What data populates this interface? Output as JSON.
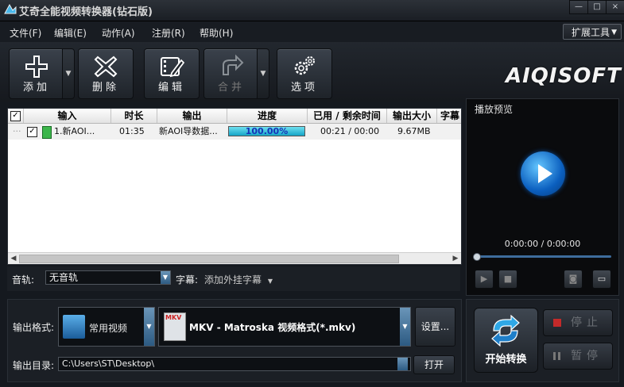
{
  "window": {
    "title": "艾奇全能视频转换器(钻石版)",
    "min": "—",
    "max": "□",
    "close": "×"
  },
  "menu": {
    "items": [
      "文件(F)",
      "编辑(E)",
      "动作(A)",
      "注册(R)",
      "帮助(H)"
    ],
    "extension_tools": "扩展工具"
  },
  "toolbar": {
    "add": "添加",
    "delete": "删除",
    "edit": "编辑",
    "merge": "合并",
    "options": "选项"
  },
  "brand": {
    "logo": "AIQISOFT"
  },
  "file_list": {
    "columns": [
      "输入",
      "时长",
      "输出",
      "进度",
      "已用 / 剩余时间",
      "输出大小",
      "字幕"
    ],
    "rows": [
      {
        "checked": true,
        "input": "1.新AOI...",
        "duration": "01:35",
        "output": "新AOI导数据...",
        "progress_percent": 100,
        "progress_text": "100.00%",
        "time": "00:21 / 00:00",
        "size": "9.67MB",
        "subtitle": ""
      }
    ]
  },
  "audio": {
    "label": "音轨:",
    "value": "无音轨",
    "subtitle_label": "字幕:",
    "subtitle_value": "添加外挂字幕"
  },
  "preview": {
    "title": "播放预览",
    "time": "0:00:00 / 0:00:00",
    "seek_fraction": 0.0
  },
  "output": {
    "format_label": "输出格式:",
    "category": "常用视频",
    "format": "MKV - Matroska 视频格式(*.mkv)",
    "format_badge": "MKV",
    "settings_button": "设置...",
    "dir_label": "输出目录:",
    "dir_value": "C:\\Users\\ST\\Desktop\\",
    "open_button": "打开"
  },
  "controls": {
    "start": "开始转换",
    "stop": "停止",
    "pause": "暂停"
  },
  "colors": {
    "accent": "#1e9ad8",
    "progress": "#15a5c7",
    "stop_red": "#c42a2a"
  }
}
